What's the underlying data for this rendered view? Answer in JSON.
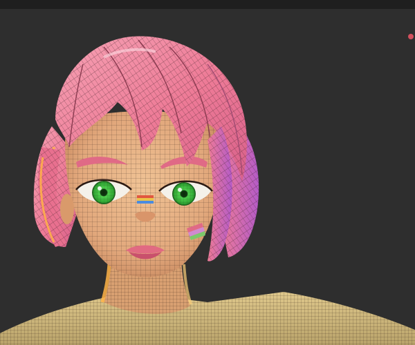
{
  "viewport": {
    "background": "#2e2e2e",
    "subject": "character-head-wireframe-render"
  },
  "colors": {
    "skin": "#e7b487",
    "hair": "#ef7e9a",
    "hair_highlight": "#f5a3b6",
    "iris": "#35c23a",
    "brows": "#e06a86",
    "lips": "#e16a82",
    "shirt": "#d8c081",
    "rim_light": "#ffb347",
    "wire": "#3a2a22",
    "gizmo": "#d2505d"
  },
  "icons": [
    "gizmo-dot-icon"
  ]
}
